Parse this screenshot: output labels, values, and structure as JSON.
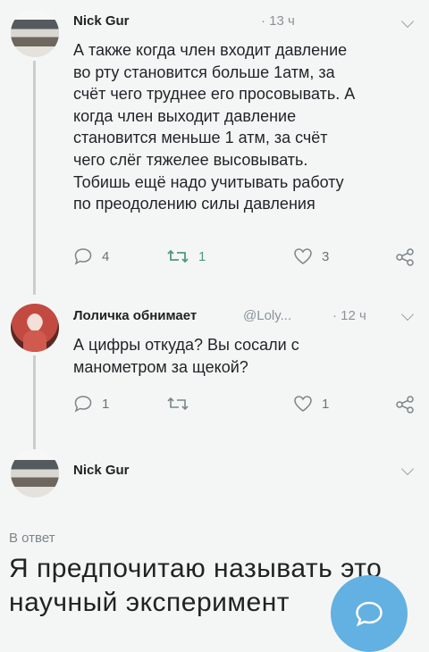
{
  "tweets": [
    {
      "author": "Nick Gur",
      "handle": "",
      "time": "· 13 ч",
      "text": "А также когда член входит давление\nво рту становится больше 1атм, за\nсчёт чего труднее его просовывать. А\nкогда член выходит давление\nстановится меньше 1 атм, за счёт\nчего слёг тяжелее высовывать.\nТобишь ещё надо учитывать работу\nпо преодолению силы давления",
      "replies": "4",
      "retweets": "1",
      "likes": "3"
    },
    {
      "author": "Лоличка обнимает",
      "handle": "@Loly...",
      "time": "· 12 ч",
      "text": "А цифры откуда? Вы сосали с\nманометром за щекой?",
      "replies": "1",
      "retweets": "",
      "likes": "1"
    },
    {
      "author": "Nick Gur"
    }
  ],
  "reply_label": "В ответ",
  "reply_text": "Я предпочитаю называть это\nнаучный эксперимент",
  "icons": {
    "avatar1": "striped-avatar",
    "avatar2": "pink-hooded-avatar",
    "fab": "compose-reply-icon"
  },
  "colors": {
    "accent": "#63b0e3",
    "retweet_green": "#4f9a7a"
  }
}
